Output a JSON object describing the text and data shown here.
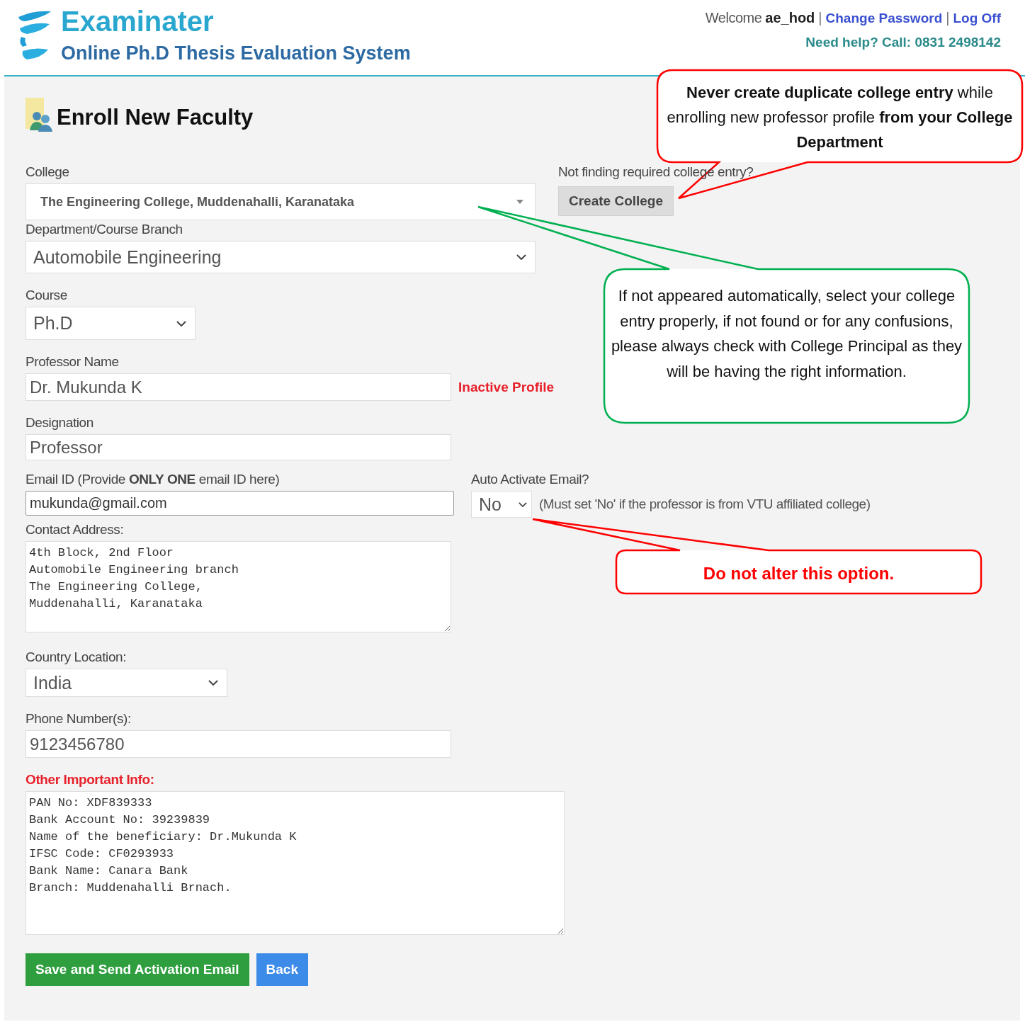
{
  "header": {
    "logo": {
      "title": "Examinater",
      "subtitle": "Online Ph.D Thesis Evaluation System"
    },
    "user_bar": [
      {
        "kind": "text",
        "text": "Welcome"
      },
      {
        "kind": "user",
        "text": "ae_hod"
      },
      {
        "kind": "separator",
        "text": "|"
      },
      {
        "kind": "link",
        "text": "Change Password"
      },
      {
        "kind": "separator",
        "text": "|"
      },
      {
        "kind": "link",
        "text": "Log Off"
      }
    ],
    "help": "Need help? Call: 0831 2498142"
  },
  "form": {
    "title": "Enroll New Faculty",
    "college": {
      "label": "College",
      "value": "The Engineering College, Muddenahalli, Karanataka",
      "side_hint": "Not finding required college entry?",
      "side_button": "Create College"
    },
    "department": {
      "label": "Department/Course Branch",
      "value": "Automobile Engineering"
    },
    "course": {
      "label": "Course",
      "value": "Ph.D"
    },
    "professor_name": {
      "label": "Professor Name",
      "value": "Dr. Mukunda K",
      "note": "Inactive Profile"
    },
    "designation": {
      "label": "Designation",
      "value": "Professor"
    },
    "email": {
      "label": "Email ID (Provide **ONLY ONE** email ID here)",
      "value": "mukunda@gmail.com"
    },
    "auto_activate": {
      "label": "Auto Activate Email?",
      "value": "No",
      "hint": "(Must set 'No' if the professor is from VTU affiliated college)"
    },
    "contact_address": {
      "label": "Contact Address:",
      "value": "4th Block, 2nd Floor\nAutomobile Engineering branch\nThe Engineering College,\nMuddenahalli, Karanataka"
    },
    "country": {
      "label": "Country Location:",
      "value": "India"
    },
    "phone": {
      "label": "Phone Number(s):",
      "value": "9123456780"
    },
    "other_info": {
      "label": "Other Important Info:",
      "value": "PAN No: XDF839333\nBank Account No: 39239839\nName of the beneficiary: Dr.Mukunda K\nIFSC Code: CF0293933\nBank Name: Canara Bank\nBranch: Muddenahalli Brnach."
    },
    "buttons": [
      {
        "kind": "primary",
        "label": "Save and Send Activation Email"
      },
      {
        "kind": "secondary",
        "label": "Back"
      }
    ]
  },
  "callouts": [
    {
      "kind": "mixed",
      "color": "#ff0000",
      "text": "**Never create duplicate college entry** while enrolling new professor profile **from your College Department**"
    },
    {
      "kind": "note",
      "color": "#00b050",
      "text": "If not appeared automatically, select your college entry properly, if not found or for any confusions, please always check with College Principal as they will be having the right information."
    },
    {
      "kind": "alert",
      "color": "#ff0000",
      "text": "Do not alter this option."
    }
  ]
}
